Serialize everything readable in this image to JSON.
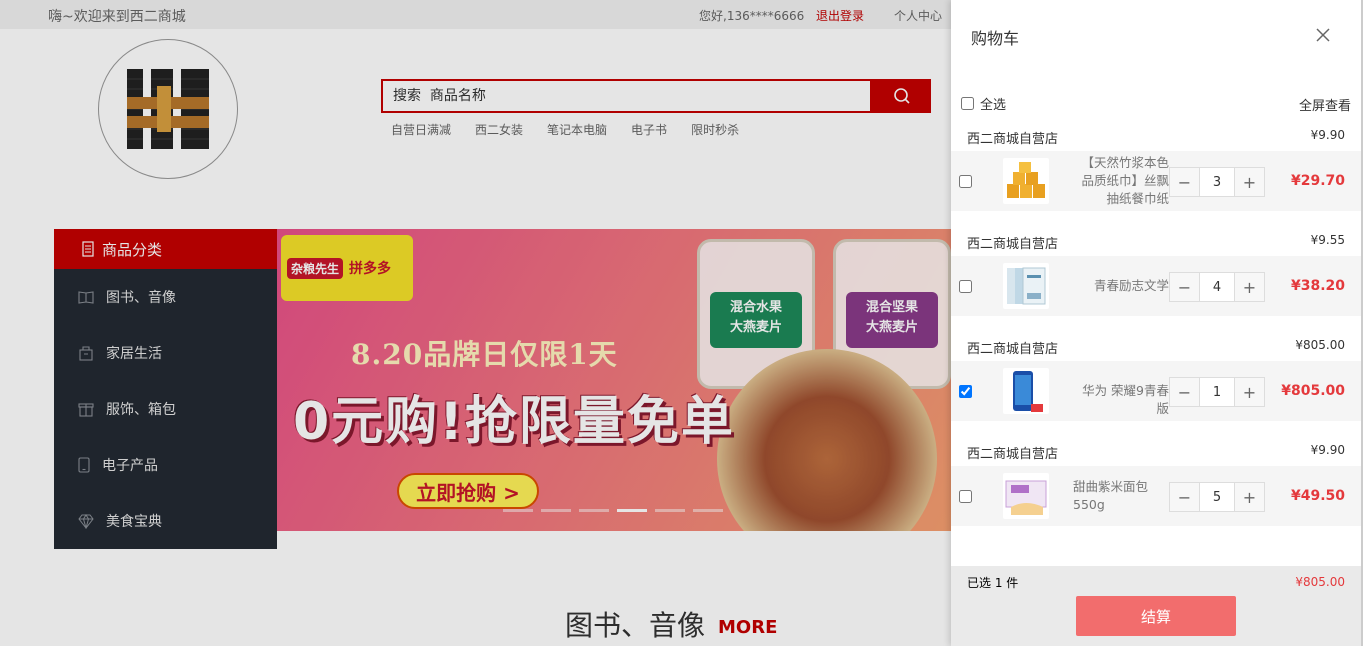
{
  "topbar": {
    "welcome": "嗨~欢迎来到西二商城",
    "hello": "您好,136****6666",
    "logout": "退出登录",
    "account": "个人中心"
  },
  "search": {
    "placeholder": "搜索  商品名称",
    "hot_links": [
      "自营日满减",
      "西二女装",
      "笔记本电脑",
      "电子书",
      "限时秒杀"
    ]
  },
  "category_nav": {
    "title": "商品分类",
    "items": [
      {
        "label": "图书、音像",
        "icon": "book-icon"
      },
      {
        "label": "家居生活",
        "icon": "home-bag-icon"
      },
      {
        "label": "服饰、箱包",
        "icon": "gift-icon"
      },
      {
        "label": "电子产品",
        "icon": "phone-icon"
      },
      {
        "label": "美食宝典",
        "icon": "diamond-icon"
      }
    ]
  },
  "banner": {
    "brand_1": "杂粮先生",
    "brand_2": "拼多多",
    "date_line": "8.20品牌日仅限1天",
    "headline": "0元购!抢限量免单",
    "cta": "立即抢购 >",
    "jar_1": "混合水果\n大燕麦片",
    "jar_2": "混合坚果\n大燕麦片",
    "active_slide": 3
  },
  "section": {
    "title": "图书、音像",
    "more": "MORE"
  },
  "cart": {
    "title": "购物车",
    "select_all": "全选",
    "fullscreen": "全屏查看",
    "stores": [
      {
        "store_name": "西二商城自营店",
        "store_price": "¥9.90",
        "item_name": "【天然竹浆本色品质纸巾】丝飘抽纸餐巾纸",
        "quantity": "3",
        "line_total": "¥29.70",
        "checked": false
      },
      {
        "store_name": "西二商城自营店",
        "store_price": "¥9.55",
        "item_name": "青春励志文学",
        "quantity": "4",
        "line_total": "¥38.20",
        "checked": false
      },
      {
        "store_name": "西二商城自营店",
        "store_price": "¥805.00",
        "item_name": "华为 荣耀9青春版",
        "quantity": "1",
        "line_total": "¥805.00",
        "checked": true
      },
      {
        "store_name": "西二商城自营店",
        "store_price": "¥9.90",
        "item_name": "甜曲紫米面包550g",
        "quantity": "5",
        "line_total": "¥49.50",
        "checked": false
      }
    ],
    "selected_count": "已选 1 件",
    "selected_total": "¥805.00",
    "checkout": "结算"
  },
  "colors": {
    "brand_red": "#c40000",
    "price_red": "#e4393c",
    "checkout_bg": "#f26d6d",
    "nav_dark": "#232a33"
  }
}
